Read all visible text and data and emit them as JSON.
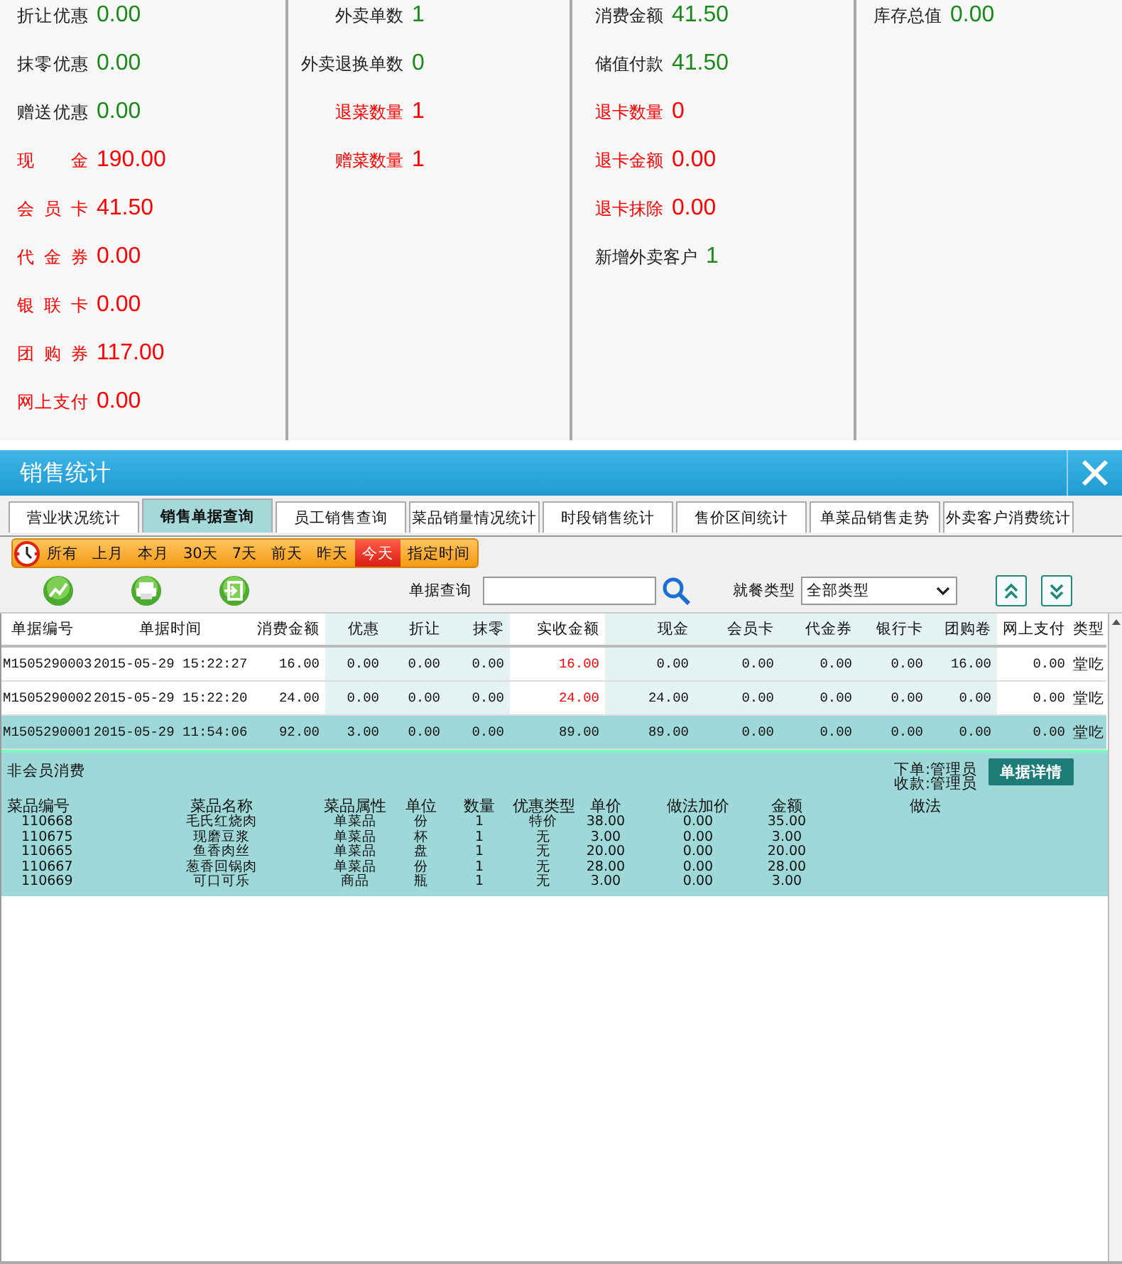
{
  "summary": {
    "columns": [
      {
        "items": [
          {
            "label": "折让优惠",
            "value": "0.00",
            "kind": "normal"
          },
          {
            "label": "抹零优惠",
            "value": "0.00",
            "kind": "normal"
          },
          {
            "label": "赠送优惠",
            "value": "0.00",
            "kind": "normal"
          },
          {
            "label": "现 金",
            "value": "190.00",
            "kind": "alert"
          },
          {
            "label": "会 员 卡",
            "value": "41.50",
            "kind": "alert"
          },
          {
            "label": "代 金 券",
            "value": "0.00",
            "kind": "alert"
          },
          {
            "label": "银 联 卡",
            "value": "0.00",
            "kind": "alert"
          },
          {
            "label": "团 购 券",
            "value": "117.00",
            "kind": "alert"
          },
          {
            "label": "网上支付",
            "value": "0.00",
            "kind": "alert"
          }
        ]
      },
      {
        "items": [
          {
            "label": "外卖单数",
            "value": "1",
            "kind": "normal"
          },
          {
            "label": "外卖退换单数",
            "value": "0",
            "kind": "normal"
          },
          {
            "label": "退菜数量",
            "value": "1",
            "kind": "alert"
          },
          {
            "label": "赠菜数量",
            "value": "1",
            "kind": "alert"
          }
        ]
      },
      {
        "items": [
          {
            "label": "消费金额",
            "value": "41.50",
            "kind": "normal"
          },
          {
            "label": "储值付款",
            "value": "41.50",
            "kind": "normal"
          },
          {
            "label": "退卡数量",
            "value": "0",
            "kind": "alert"
          },
          {
            "label": "退卡金额",
            "value": "0.00",
            "kind": "alert"
          },
          {
            "label": "退卡抹除",
            "value": "0.00",
            "kind": "alert"
          },
          {
            "label": "新增外卖客户",
            "value": "1",
            "kind": "normal"
          }
        ]
      },
      {
        "items": [
          {
            "label": "库存总值",
            "value": "0.00",
            "kind": "normal"
          }
        ]
      }
    ]
  },
  "window": {
    "title": "销售统计"
  },
  "tabs": [
    {
      "label": "营业状况统计",
      "selected": false
    },
    {
      "label": "销售单据查询",
      "selected": true
    },
    {
      "label": "员工销售查询",
      "selected": false
    },
    {
      "label": "菜品销量情况统计",
      "selected": false
    },
    {
      "label": "时段销售统计",
      "selected": false
    },
    {
      "label": "售价区间统计",
      "selected": false
    },
    {
      "label": "单菜品销售走势",
      "selected": false
    },
    {
      "label": "外卖客户消费统计",
      "selected": false
    }
  ],
  "date_filter": [
    {
      "label": "所有",
      "selected": false
    },
    {
      "label": "上月",
      "selected": false
    },
    {
      "label": "本月",
      "selected": false
    },
    {
      "label": "30天",
      "selected": false
    },
    {
      "label": "7天",
      "selected": false
    },
    {
      "label": "前天",
      "selected": false
    },
    {
      "label": "昨天",
      "selected": false
    },
    {
      "label": "今天",
      "selected": true
    },
    {
      "label": "指定时间",
      "selected": false
    }
  ],
  "search": {
    "label": "单据查询"
  },
  "dining_type": {
    "label": "就餐类型",
    "value": "全部类型"
  },
  "bills": {
    "columns": [
      "单据编号",
      "单据时间",
      "消费金额",
      "优惠",
      "折让",
      "抹零",
      "实收金额",
      "现金",
      "会员卡",
      "代金券",
      "银行卡",
      "团购卷",
      "网上支付",
      "类型"
    ],
    "rows": [
      {
        "cells": [
          "M1505290003",
          "2015-05-29 15:22:27",
          "16.00",
          "0.00",
          "0.00",
          "0.00",
          "16.00",
          "0.00",
          "0.00",
          "0.00",
          "0.00",
          "16.00",
          "0.00",
          "堂吃"
        ],
        "selected": false
      },
      {
        "cells": [
          "M1505290002",
          "2015-05-29 15:22:20",
          "24.00",
          "0.00",
          "0.00",
          "0.00",
          "24.00",
          "24.00",
          "0.00",
          "0.00",
          "0.00",
          "0.00",
          "0.00",
          "堂吃"
        ],
        "selected": false
      },
      {
        "cells": [
          "M1505290001",
          "2015-05-29 11:54:06",
          "92.00",
          "3.00",
          "0.00",
          "0.00",
          "89.00",
          "89.00",
          "0.00",
          "0.00",
          "0.00",
          "0.00",
          "0.00",
          "堂吃"
        ],
        "selected": true
      }
    ]
  },
  "detail": {
    "title": "非会员消费",
    "order_by": "下单:管理员",
    "paid_by": "收款:管理员",
    "button": "单据详情",
    "columns": [
      "菜品编号",
      "菜品名称",
      "菜品属性",
      "单位",
      "数量",
      "优惠类型",
      "单价",
      "做法加价",
      "金额",
      "做法"
    ],
    "rows": [
      [
        "110668",
        "毛氏红烧肉",
        "单菜品",
        "份",
        "1",
        "特价",
        "38.00",
        "0.00",
        "35.00"
      ],
      [
        "110675",
        "现磨豆浆",
        "单菜品",
        "杯",
        "1",
        "无",
        "3.00",
        "0.00",
        "3.00"
      ],
      [
        "110665",
        "鱼香肉丝",
        "单菜品",
        "盘",
        "1",
        "无",
        "20.00",
        "0.00",
        "20.00"
      ],
      [
        "110667",
        "葱香回锅肉",
        "单菜品",
        "份",
        "1",
        "无",
        "28.00",
        "0.00",
        "28.00"
      ],
      [
        "110669",
        "可口可乐",
        "商品",
        "瓶",
        "1",
        "无",
        "3.00",
        "0.00",
        "3.00"
      ]
    ]
  }
}
